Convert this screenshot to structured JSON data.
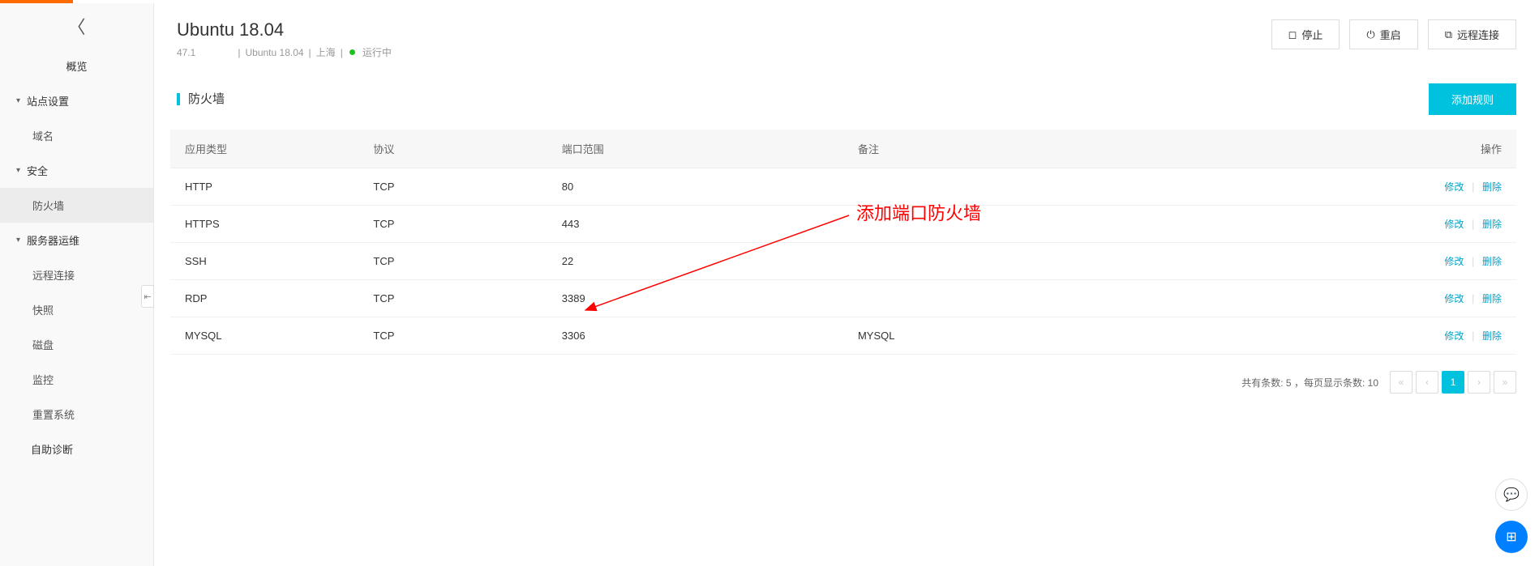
{
  "header": {
    "title": "Ubuntu 18.04",
    "ip": "47.1",
    "os": "Ubuntu 18.04",
    "region": "上海",
    "status": "运行中",
    "actions": {
      "stop": "停止",
      "restart": "重启",
      "remote": "远程连接"
    }
  },
  "sidebar": {
    "overview": "概览",
    "site_settings": "站点设置",
    "domain": "域名",
    "security": "安全",
    "firewall": "防火墙",
    "server_ops": "服务器运维",
    "remote": "远程连接",
    "snapshot": "快照",
    "disk": "磁盘",
    "monitor": "监控",
    "reinstall": "重置系统",
    "self_diag": "自助诊断"
  },
  "section": {
    "title": "防火墙",
    "add_rule": "添加规则"
  },
  "table": {
    "headers": {
      "app_type": "应用类型",
      "protocol": "协议",
      "port_range": "端口范围",
      "note": "备注",
      "ops": "操作"
    },
    "rows": [
      {
        "app": "HTTP",
        "proto": "TCP",
        "port": "80",
        "note": ""
      },
      {
        "app": "HTTPS",
        "proto": "TCP",
        "port": "443",
        "note": ""
      },
      {
        "app": "SSH",
        "proto": "TCP",
        "port": "22",
        "note": ""
      },
      {
        "app": "RDP",
        "proto": "TCP",
        "port": "3389",
        "note": ""
      },
      {
        "app": "MYSQL",
        "proto": "TCP",
        "port": "3306",
        "note": "MYSQL"
      }
    ],
    "actions": {
      "edit": "修改",
      "delete": "删除"
    }
  },
  "pagination": {
    "total_label": "共有条数:",
    "total": "5",
    "per_page_label": "，每页显示条数:",
    "per_page": "10",
    "current": "1"
  },
  "annotation": {
    "text": "添加端口防火墙"
  }
}
